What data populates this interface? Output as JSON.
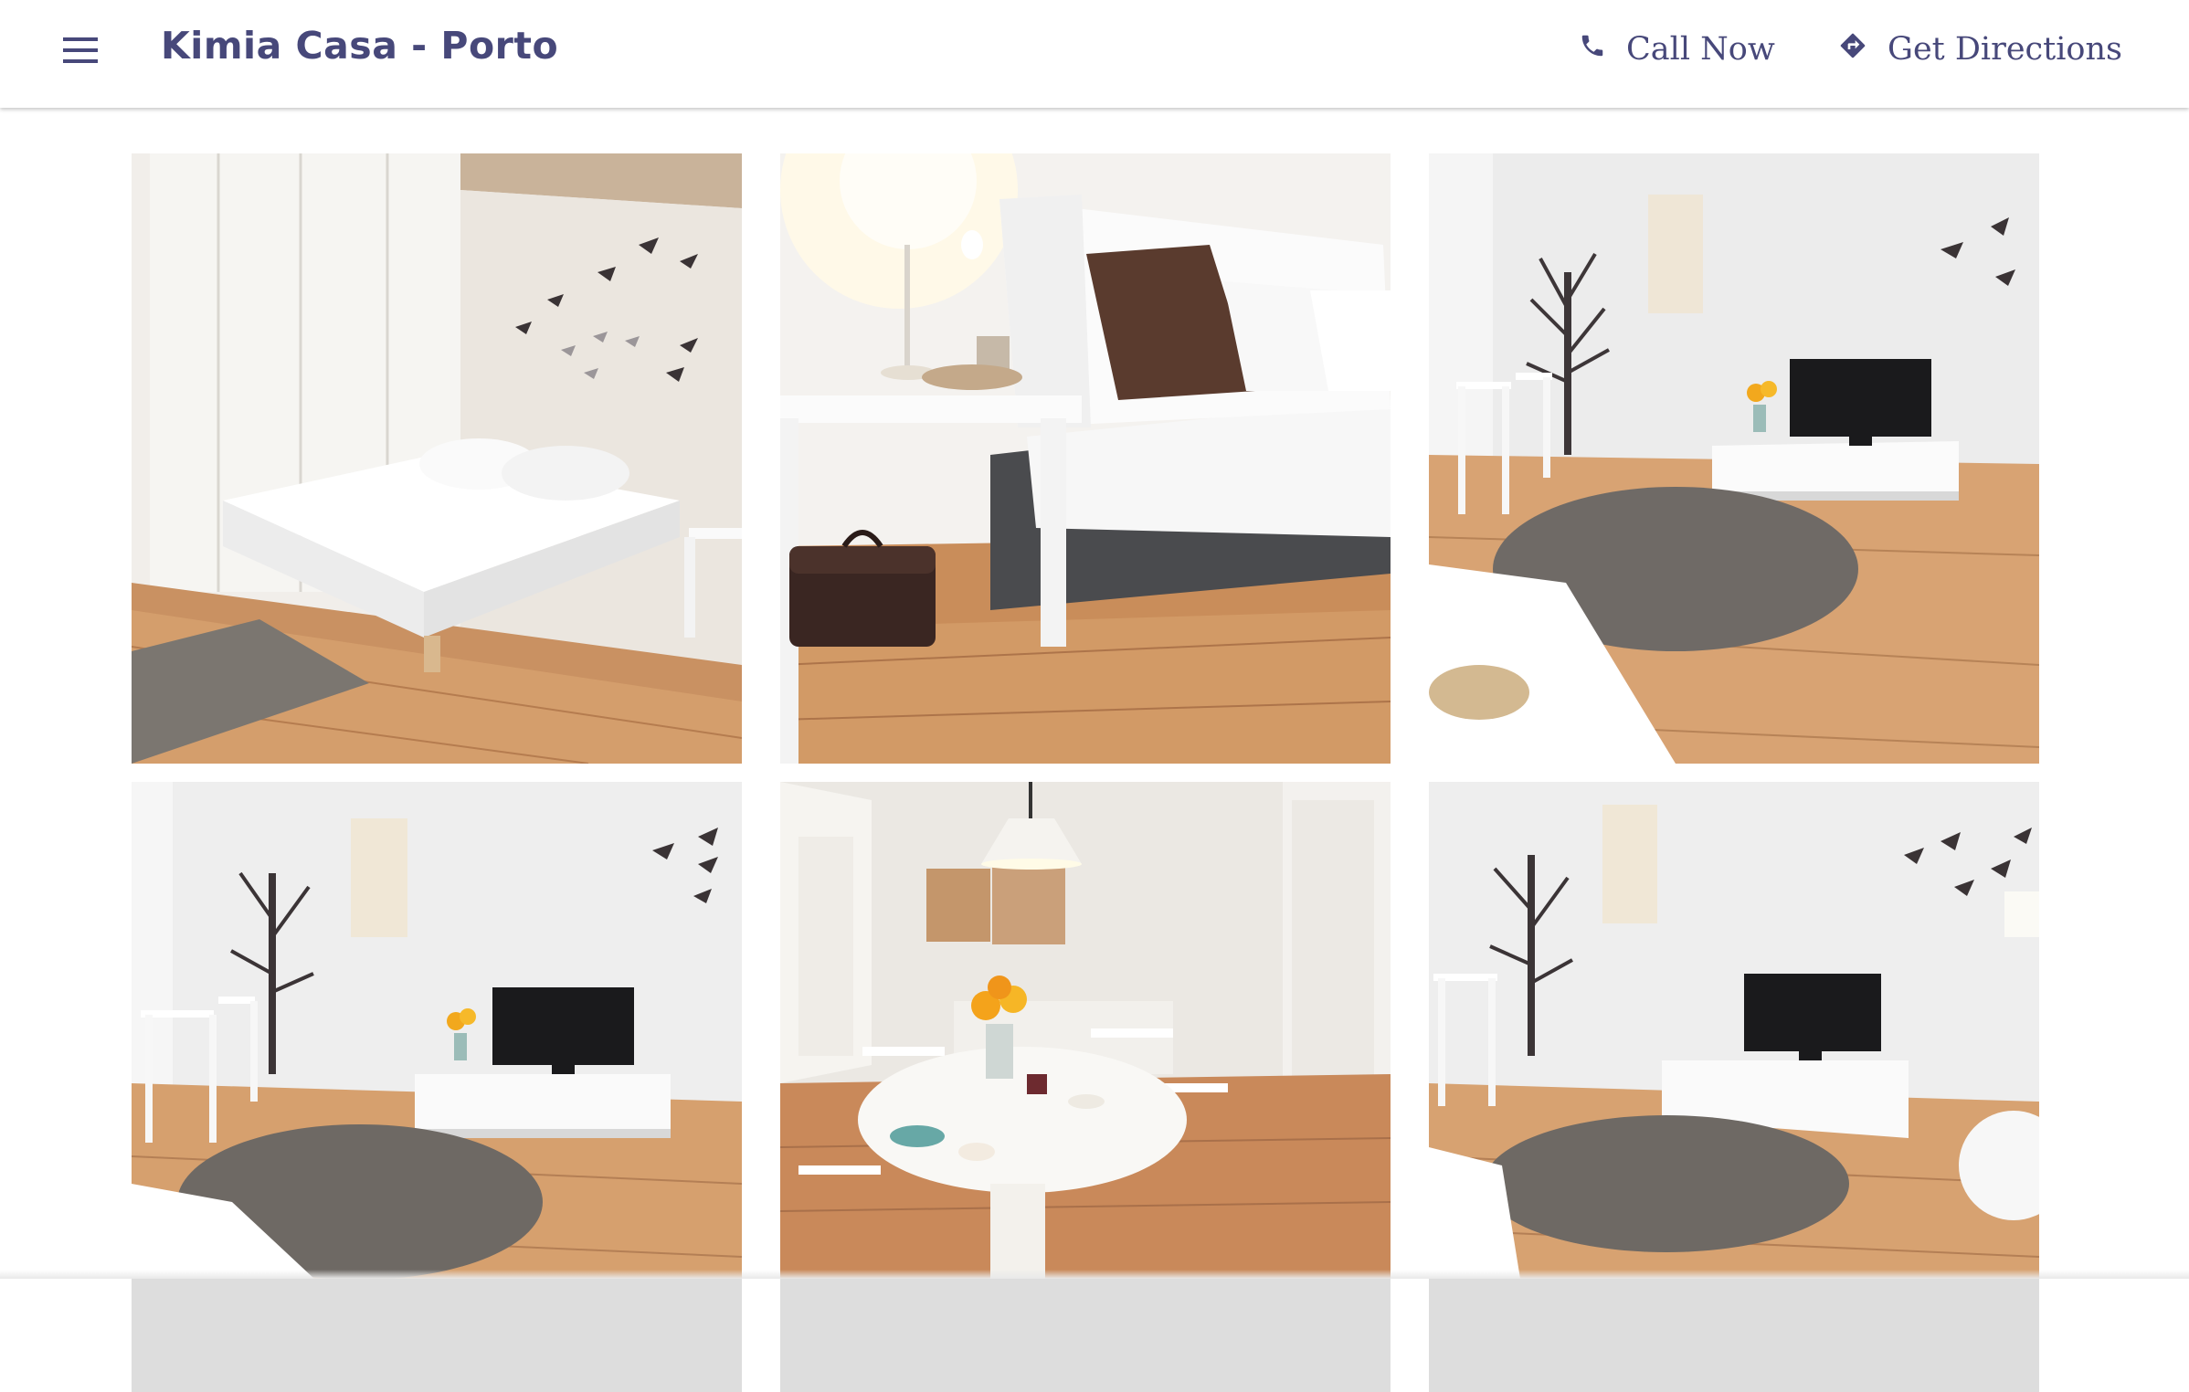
{
  "header": {
    "title": "Kimia Casa - Porto",
    "menu_icon": "hamburger-menu-icon",
    "actions": [
      {
        "label": "Call Now",
        "icon": "phone-icon"
      },
      {
        "label": "Get Directions",
        "icon": "directions-icon"
      }
    ]
  },
  "colors": {
    "brand": "#47487a",
    "background": "#ffffff"
  },
  "gallery": {
    "photos": [
      {
        "subject": "bedroom-photo"
      },
      {
        "subject": "sofa-bed-photo"
      },
      {
        "subject": "living-room-photo"
      },
      {
        "subject": "living-room-tv-photo"
      },
      {
        "subject": "dining-table-photo"
      },
      {
        "subject": "living-room-wide-photo"
      }
    ]
  }
}
